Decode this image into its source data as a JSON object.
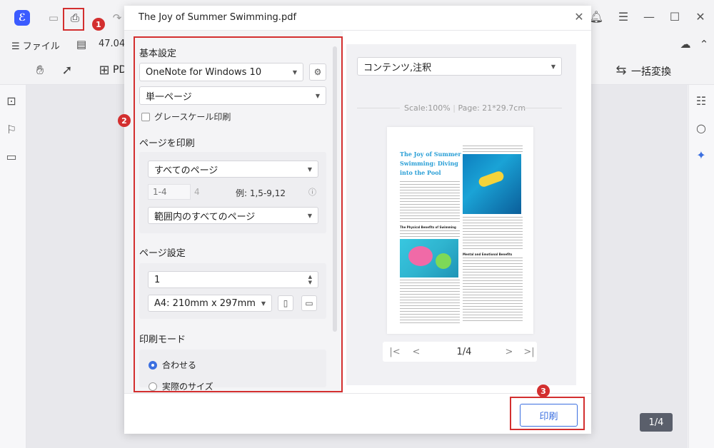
{
  "app": {
    "menu_file": "ファイル",
    "zoom": "47.04%",
    "toolbar_pdf_partial": "PD",
    "batch_convert": "一括変換",
    "page_indicator": "1/4"
  },
  "dialog": {
    "title": "The Joy of Summer Swimming.pdf",
    "basic": {
      "title": "基本設定",
      "printer": "OneNote for Windows 10",
      "page_mode": "単一ページ",
      "grayscale_label": "グレースケール印刷",
      "grayscale_checked": false
    },
    "print_pages": {
      "title": "ページを印刷",
      "range_select": "すべてのページ",
      "range_input_placeholder": "1-4",
      "total": "4",
      "example": "例: 1,5-9,12",
      "subset_select": "範囲内のすべてのページ"
    },
    "page_setup": {
      "title": "ページ設定",
      "copies": "1",
      "paper_size": "A4: 210mm x 297mm"
    },
    "print_mode": {
      "title": "印刷モード",
      "options": [
        {
          "label": "合わせる",
          "selected": true
        },
        {
          "label": "実際のサイズ",
          "selected": false
        }
      ]
    },
    "preview": {
      "content_select": "コンテンツ,注釈",
      "scale": "Scale:100%",
      "page_size": "Page: 21*29.7cm",
      "doc_title": "The Joy of Summer Swimming: Diving into the Pool",
      "heading_physical": "The Physical Benefits of Swimming",
      "heading_mental": "Mental and Emotional Benefits",
      "pager_value": "1/4"
    },
    "print_button": "印刷"
  },
  "annotations": {
    "marker1": "1",
    "marker2": "2",
    "marker3": "3",
    "annotation_color": "#d32f2f"
  },
  "colors": {
    "accent": "#3b6fe0",
    "title_blue": "#2a9fd6"
  }
}
